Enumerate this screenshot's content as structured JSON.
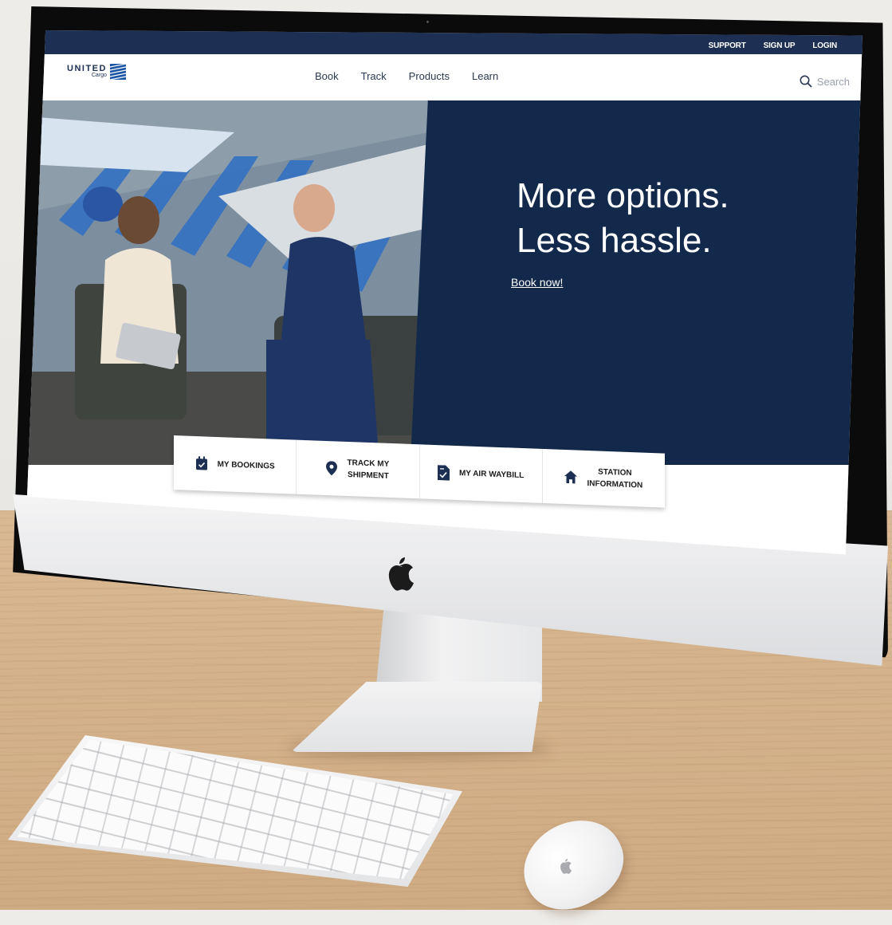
{
  "utility_nav": {
    "support": "SUPPORT",
    "sign_up": "SIGN UP",
    "login": "LOGIN"
  },
  "brand": {
    "name": "UNITED",
    "sub": "Cargo"
  },
  "main_nav": [
    {
      "label": "Book"
    },
    {
      "label": "Track"
    },
    {
      "label": "Products"
    },
    {
      "label": "Learn"
    }
  ],
  "search": {
    "placeholder": "Search",
    "icon": "search-icon"
  },
  "hero": {
    "headline_line1": "More options.",
    "headline_line2": "Less hassle.",
    "cta": "Book now!"
  },
  "quick_links": [
    {
      "label": "MY BOOKINGS",
      "icon": "calendar-check-icon"
    },
    {
      "label_line1": "TRACK MY",
      "label_line2": "SHIPMENT",
      "icon": "map-pin-icon"
    },
    {
      "label": "MY AIR WAYBILL",
      "icon": "document-check-icon"
    },
    {
      "label_line1": "STATION",
      "label_line2": "INFORMATION",
      "icon": "home-icon"
    }
  ],
  "colors": {
    "navy": "#13294b",
    "utility_bar": "#1d2f52",
    "white": "#ffffff"
  }
}
